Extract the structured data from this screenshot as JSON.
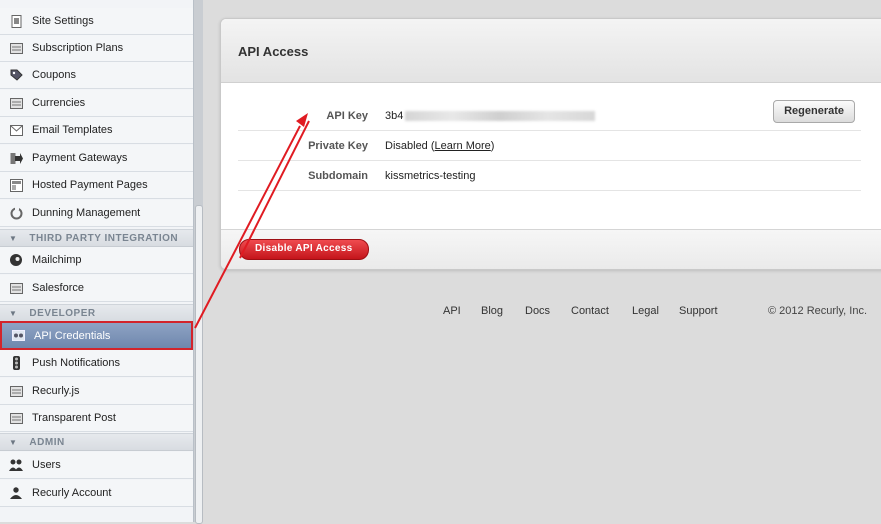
{
  "sidebar": {
    "items_top": [
      {
        "label": "Site Settings",
        "icon": "document-icon"
      },
      {
        "label": "Subscription Plans",
        "icon": "list-icon"
      },
      {
        "label": "Coupons",
        "icon": "tag-icon"
      },
      {
        "label": "Currencies",
        "icon": "list-icon"
      },
      {
        "label": "Email Templates",
        "icon": "envelope-icon"
      },
      {
        "label": "Payment Gateways",
        "icon": "arrow-gateway-icon"
      },
      {
        "label": "Hosted Payment Pages",
        "icon": "page-icon"
      },
      {
        "label": "Dunning Management",
        "icon": "refresh-icon"
      }
    ],
    "section_third_party": "THIRD PARTY INTEGRATION",
    "items_third_party": [
      {
        "label": "Mailchimp",
        "icon": "mailchimp-icon"
      },
      {
        "label": "Salesforce",
        "icon": "list-icon"
      }
    ],
    "section_developer": "DEVELOPER",
    "items_developer": [
      {
        "label": "API Credentials",
        "icon": "credentials-icon"
      },
      {
        "label": "Push Notifications",
        "icon": "traffic-light-icon"
      },
      {
        "label": "Recurly.js",
        "icon": "list-icon"
      },
      {
        "label": "Transparent Post",
        "icon": "list-icon"
      }
    ],
    "section_admin": "ADMIN",
    "items_admin": [
      {
        "label": "Users",
        "icon": "users-icon"
      },
      {
        "label": "Recurly Account",
        "icon": "user-icon"
      }
    ]
  },
  "panel": {
    "title": "API Access",
    "rows": [
      {
        "label": "API Key",
        "value_prefix": "3b4"
      },
      {
        "label": "Private Key",
        "value_prefix": "Disabled (",
        "link": "Learn More",
        "value_suffix": ")"
      },
      {
        "label": "Subdomain",
        "value": "kissmetrics-testing"
      }
    ],
    "regenerate_label": "Regenerate",
    "disable_label": "Disable API Access"
  },
  "footer": {
    "links": [
      "API",
      "Blog",
      "Docs",
      "Contact",
      "Legal",
      "Support"
    ],
    "copyright": "© 2012 Recurly, Inc."
  },
  "colors": {
    "accent_red": "#d3242b",
    "active_nav": "#7a90b5"
  }
}
